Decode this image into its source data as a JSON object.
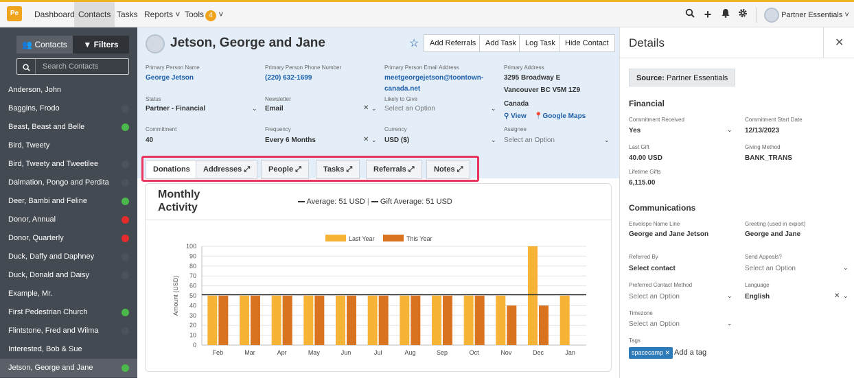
{
  "topbar": {
    "logo": "Pe",
    "nav": [
      "Dashboard",
      "Contacts",
      "Tasks",
      "Reports ˅",
      "Tools"
    ],
    "tools_badge": "4",
    "user": "Partner Essentials ˅",
    "icons": [
      "search-icon",
      "plus-icon",
      "bell-icon",
      "gear-icon"
    ]
  },
  "sidebar": {
    "contacts_btn": "👥 Contacts",
    "filters_btn": "▼ Filters",
    "search_placeholder": "Search Contacts",
    "items": [
      {
        "name": "Anderson, John",
        "status": "none"
      },
      {
        "name": "Baggins, Frodo",
        "status": "gray"
      },
      {
        "name": "Beast, Beast and Belle",
        "status": "green"
      },
      {
        "name": "Bird, Tweety",
        "status": "none"
      },
      {
        "name": "Bird, Tweety and Tweetilee",
        "status": "gray"
      },
      {
        "name": "Dalmation, Pongo and Perdita",
        "status": "gray"
      },
      {
        "name": "Deer, Bambi and Feline",
        "status": "green"
      },
      {
        "name": "Donor, Annual",
        "status": "red"
      },
      {
        "name": "Donor, Quarterly",
        "status": "red"
      },
      {
        "name": "Duck, Daffy and Daphney",
        "status": "gray"
      },
      {
        "name": "Duck, Donald and Daisy",
        "status": "gray"
      },
      {
        "name": "Example, Mr.",
        "status": "none"
      },
      {
        "name": "First Pedestrian Church",
        "status": "green"
      },
      {
        "name": "Flintstone, Fred and Wilma",
        "status": "gray"
      },
      {
        "name": "Interested, Bob & Sue",
        "status": "none"
      },
      {
        "name": "Jetson, George and Jane",
        "status": "green"
      }
    ],
    "selected_index": 15
  },
  "header": {
    "title": "Jetson, George and Jane",
    "buttons": [
      "Add Referrals",
      "Add Task",
      "Log Task",
      "Hide Contact"
    ],
    "fields": {
      "primary_name_label": "Primary Person Name",
      "primary_name": "George Jetson",
      "phone_label": "Primary Person Phone Number",
      "phone": "(220) 632-1699",
      "email_label": "Primary Person Email Address",
      "email_line1": "meetgeorgejetson@toontown-",
      "email_line2": "canada.net",
      "address_label": "Primary Address",
      "address_line1": "3295 Broadway E",
      "address_line2": "Vancouver BC V5M 1Z9",
      "address_line3": "Canada",
      "view_link": "View",
      "maps_link": "Google Maps",
      "status_label": "Status",
      "status": "Partner - Financial",
      "newsletter_label": "Newsletter",
      "newsletter": "Email",
      "likely_label": "Likely to Give",
      "likely": "Select an Option",
      "commitment_label": "Commitment",
      "commitment": "40",
      "frequency_label": "Frequency",
      "frequency": "Every 6 Months",
      "currency_label": "Currency",
      "currency": "USD ($)",
      "assignee_label": "Assignee",
      "assignee": "Select an Option"
    },
    "tabs": [
      "Donations",
      "Addresses",
      "People",
      "Tasks",
      "Referrals",
      "Notes"
    ]
  },
  "chart_card": {
    "title_line1": "Monthly",
    "title_line2": "Activity",
    "average_text": "Average: 51 USD",
    "separator": "|",
    "gift_average_text": "Gift Average: 51 USD"
  },
  "chart_data": {
    "type": "bar",
    "categories": [
      "Feb",
      "Mar",
      "Apr",
      "May",
      "Jun",
      "Jul",
      "Aug",
      "Sep",
      "Oct",
      "Nov",
      "Dec",
      "Jan"
    ],
    "series": [
      {
        "name": "Last Year",
        "values": [
          50,
          50,
          50,
          50,
          50,
          50,
          50,
          50,
          50,
          50,
          100,
          50
        ]
      },
      {
        "name": "This Year",
        "values": [
          50,
          50,
          50,
          50,
          50,
          50,
          50,
          50,
          50,
          40,
          40,
          0
        ]
      }
    ],
    "ylabel": "Amount (USD)",
    "ylim": [
      0,
      100
    ],
    "yticks": [
      0,
      10,
      20,
      30,
      40,
      50,
      60,
      70,
      80,
      90,
      100
    ],
    "average_line": 51,
    "colors": {
      "Last Year": "#f6b335",
      "This Year": "#d9731f"
    },
    "legend_position": "top"
  },
  "details": {
    "title": "Details",
    "source_label": "Source:",
    "source_value": "Partner Essentials",
    "financial_heading": "Financial",
    "commitment_received_label": "Commitment Received",
    "commitment_received": "Yes",
    "commitment_start_label": "Commitment Start Date",
    "commitment_start": "12/13/2023",
    "last_gift_label": "Last Gift",
    "last_gift": "40.00 USD",
    "giving_method_label": "Giving Method",
    "giving_method": "BANK_TRANS",
    "lifetime_label": "Lifetime Gifts",
    "lifetime": "6,115.00",
    "communications_heading": "Communications",
    "envelope_label": "Envelope Name Line",
    "envelope": "George and Jane Jetson",
    "greeting_label": "Greeting (used in export)",
    "greeting": "George and Jane",
    "referred_label": "Referred By",
    "referred": "Select contact",
    "appeals_label": "Send Appeals?",
    "appeals": "Select an Option",
    "pref_contact_label": "Preferred Contact Method",
    "pref_contact": "Select an Option",
    "language_label": "Language",
    "language": "English",
    "timezone_label": "Timezone",
    "timezone": "Select an Option",
    "tags_label": "Tags",
    "tag": "spacecamp",
    "add_tag": "Add a tag"
  }
}
